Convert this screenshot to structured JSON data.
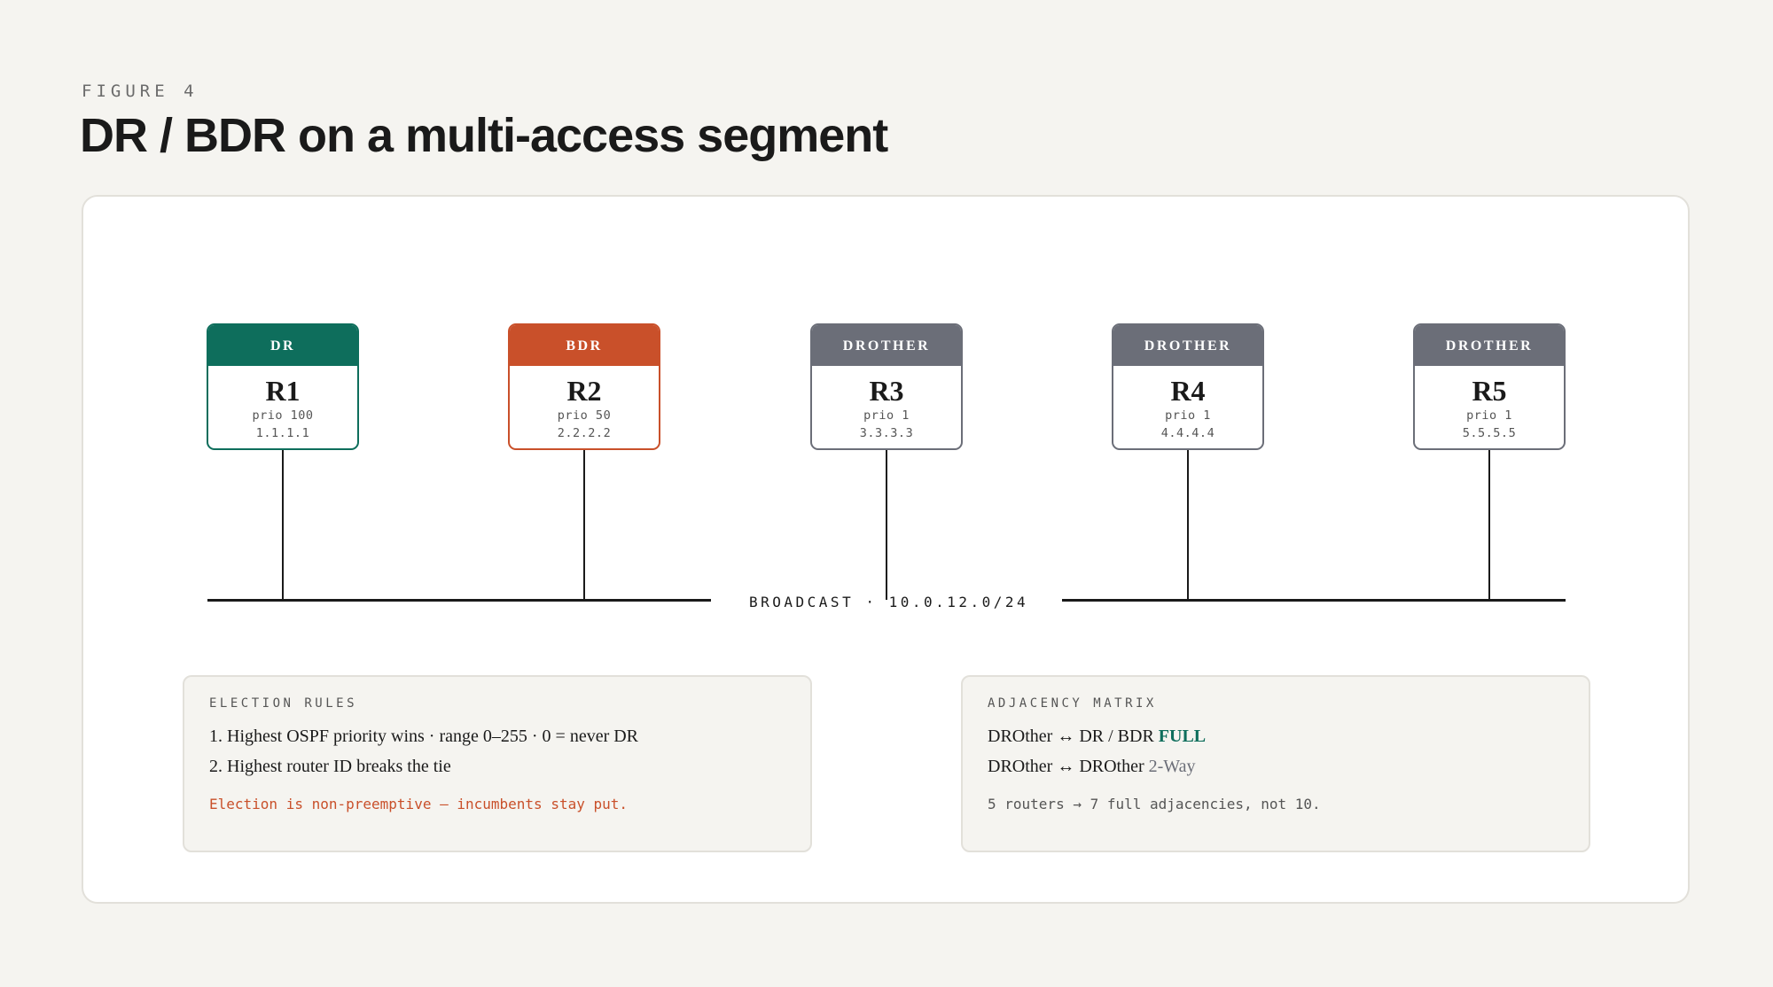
{
  "figure": {
    "label": "FIGURE 4",
    "title": "DR / BDR on a multi-access segment"
  },
  "colors": {
    "dr": "#0e6e5c",
    "bdr": "#c9502a",
    "drother": "#6b6e78",
    "bus": "#1a1a1a",
    "background": "#f5f4f0"
  },
  "routers": [
    {
      "role": "DR",
      "name": "R1",
      "priority": "prio 100",
      "router_id": "1.1.1.1"
    },
    {
      "role": "BDR",
      "name": "R2",
      "priority": "prio 50",
      "router_id": "2.2.2.2"
    },
    {
      "role": "DROTHER",
      "name": "R3",
      "priority": "prio 1",
      "router_id": "3.3.3.3"
    },
    {
      "role": "DROTHER",
      "name": "R4",
      "priority": "prio 1",
      "router_id": "4.4.4.4"
    },
    {
      "role": "DROTHER",
      "name": "R5",
      "priority": "prio 1",
      "router_id": "5.5.5.5"
    }
  ],
  "segment": {
    "label": "BROADCAST · 10.0.12.0/24"
  },
  "election_rules": {
    "title": "ELECTION RULES",
    "rules": [
      "1. Highest OSPF priority wins · range 0–255 · 0 = never DR",
      "2. Highest router ID breaks the tie"
    ],
    "note": "Election is non-preemptive — incumbents stay put."
  },
  "adjacency_matrix": {
    "title": "ADJACENCY MATRIX",
    "rows": [
      {
        "pair": "DROther ↔ DR / BDR",
        "state": "FULL"
      },
      {
        "pair": "DROther ↔ DROther",
        "state": "2-Way"
      }
    ],
    "note": "5 routers → 7 full adjacencies, not 10."
  }
}
